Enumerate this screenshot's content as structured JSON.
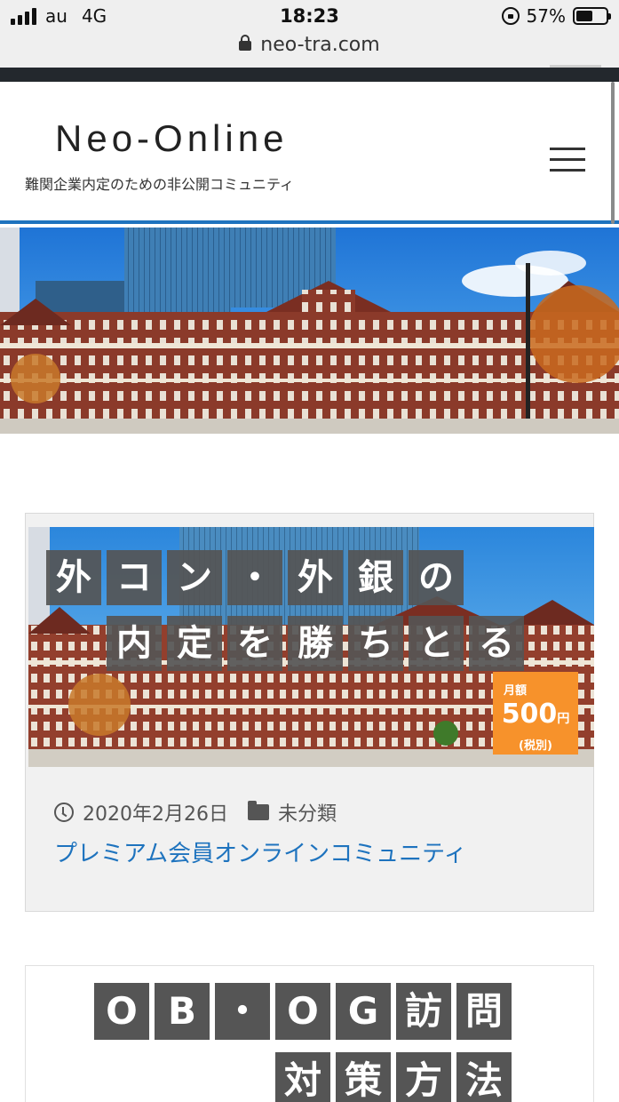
{
  "status_bar": {
    "carrier": "au",
    "network": "4G",
    "time": "18:23",
    "battery": "57%",
    "battery_level": 0.57
  },
  "browser": {
    "url": "neo-tra.com"
  },
  "site": {
    "title": "Neo-Online",
    "description": "難関企業内定のための非公開コミュニティ"
  },
  "post": {
    "thumb_line1": [
      "外",
      "コ",
      "ン",
      "・",
      "外",
      "銀",
      "の"
    ],
    "thumb_line2": [
      "内",
      "定",
      "を",
      "勝",
      "ち",
      "と",
      "る"
    ],
    "price_label": "月額",
    "price_value": "500",
    "price_unit": "円",
    "price_note": "(税別)",
    "date": "2020年2月26日",
    "category": "未分類",
    "title": "プレミアム会員オンラインコミュニティ"
  },
  "post2": {
    "thumb_line1": [
      "O",
      "B",
      "・",
      "O",
      "G",
      "訪",
      "問"
    ],
    "thumb_line2": [
      "対",
      "策",
      "方",
      "法"
    ]
  },
  "colors": {
    "accent": "#1e73be",
    "header_dark": "#23282d",
    "badge_orange": "#f7922b",
    "tile_gray": "#555555"
  }
}
